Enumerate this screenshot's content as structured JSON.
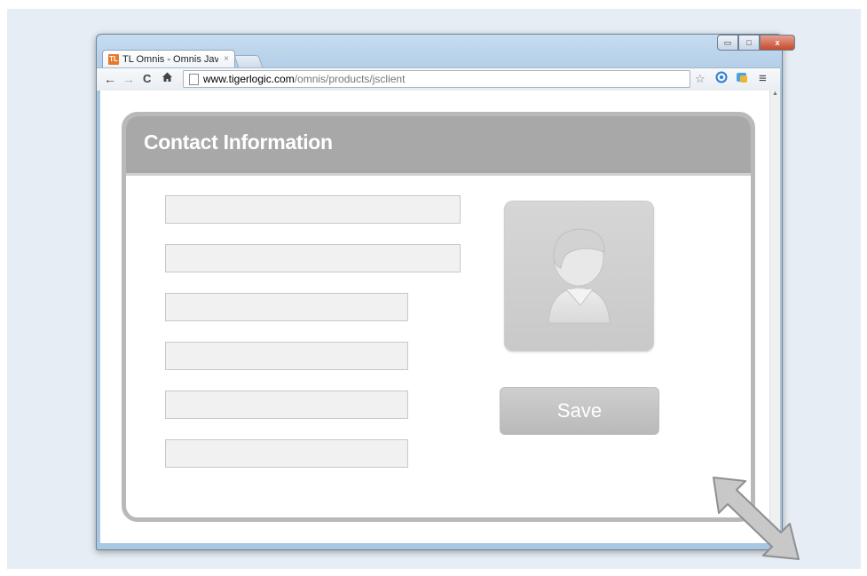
{
  "browser": {
    "tab": {
      "favicon_text": "TL",
      "title": "TL Omnis - Omnis JavaScr",
      "close_glyph": "×"
    },
    "window_controls": {
      "minimize": "▭",
      "maximize": "□",
      "close": "x"
    },
    "nav": {
      "back": "←",
      "forward": "→",
      "reload": "C",
      "home": "🏠"
    },
    "address": {
      "host": "www.tigerlogic.com",
      "path": "/omnis/products/jsclient"
    },
    "right_icons": {
      "bookmark_star": "☆",
      "menu": "≡"
    }
  },
  "panel": {
    "title": "Contact Information",
    "fields": [
      "",
      "",
      "",
      "",
      "",
      ""
    ],
    "save_label": "Save"
  },
  "colors": {
    "panel_header": "#a8a8a8",
    "panel_border": "#b7bab9",
    "field_bg": "#f1f1f1",
    "save_button": "#c4c4c4"
  },
  "icons": [
    "favicon-icon",
    "back-icon",
    "forward-icon",
    "reload-icon",
    "home-icon",
    "page-icon",
    "star-icon",
    "extension-icon",
    "menu-icon",
    "person-avatar-icon",
    "resize-arrow-icon"
  ]
}
